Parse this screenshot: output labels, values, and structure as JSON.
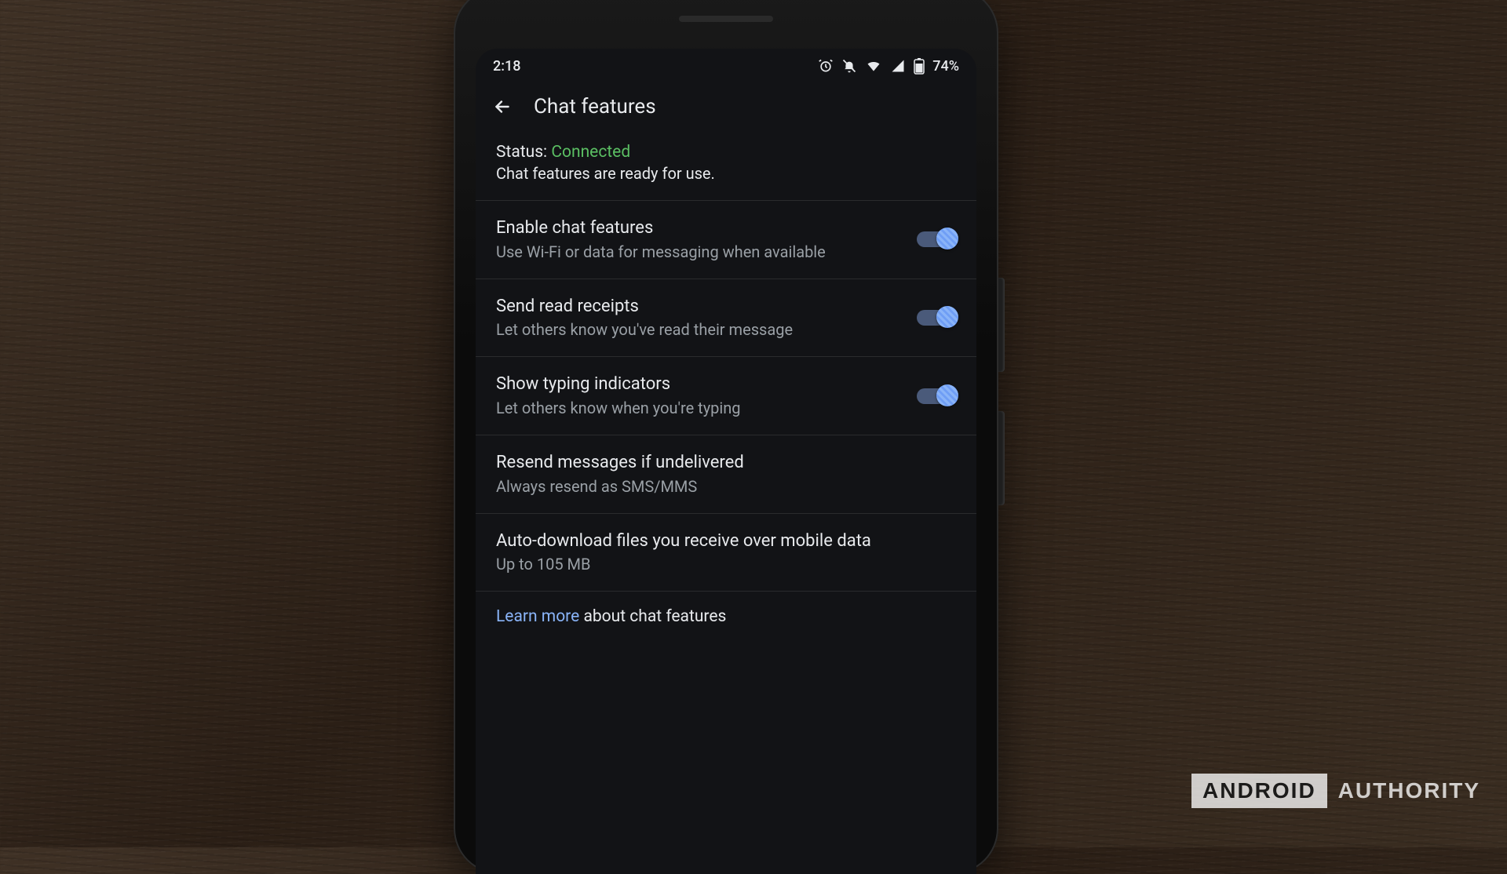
{
  "statusbar": {
    "time": "2:18",
    "battery_text": "74%",
    "icons": {
      "alarm": "alarm-icon",
      "dnd": "notifications-off-icon",
      "wifi": "wifi-icon",
      "signal": "cell-signal-icon",
      "battery": "battery-icon"
    }
  },
  "appbar": {
    "title": "Chat features"
  },
  "status": {
    "label": "Status: ",
    "value": "Connected",
    "subtitle": "Chat features are ready for use."
  },
  "settings": [
    {
      "title": "Enable chat features",
      "subtitle": "Use Wi-Fi or data for messaging when available",
      "toggle": true,
      "on": true
    },
    {
      "title": "Send read receipts",
      "subtitle": "Let others know you've read their message",
      "toggle": true,
      "on": true
    },
    {
      "title": "Show typing indicators",
      "subtitle": "Let others know when you're typing",
      "toggle": true,
      "on": true
    },
    {
      "title": "Resend messages if undelivered",
      "subtitle": "Always resend as SMS/MMS",
      "toggle": false
    },
    {
      "title": "Auto-download files you receive over mobile data",
      "subtitle": "Up to 105 MB",
      "toggle": false
    }
  ],
  "learn": {
    "link": "Learn more",
    "rest": " about chat features"
  },
  "watermark": {
    "brand": "ANDROID",
    "word": "AUTHORITY"
  },
  "colors": {
    "accent": "#8ab4f8",
    "status_ok": "#5bbf63",
    "bg": "#121316",
    "text": "#e8eaed",
    "subtext": "#9aa0a6"
  }
}
